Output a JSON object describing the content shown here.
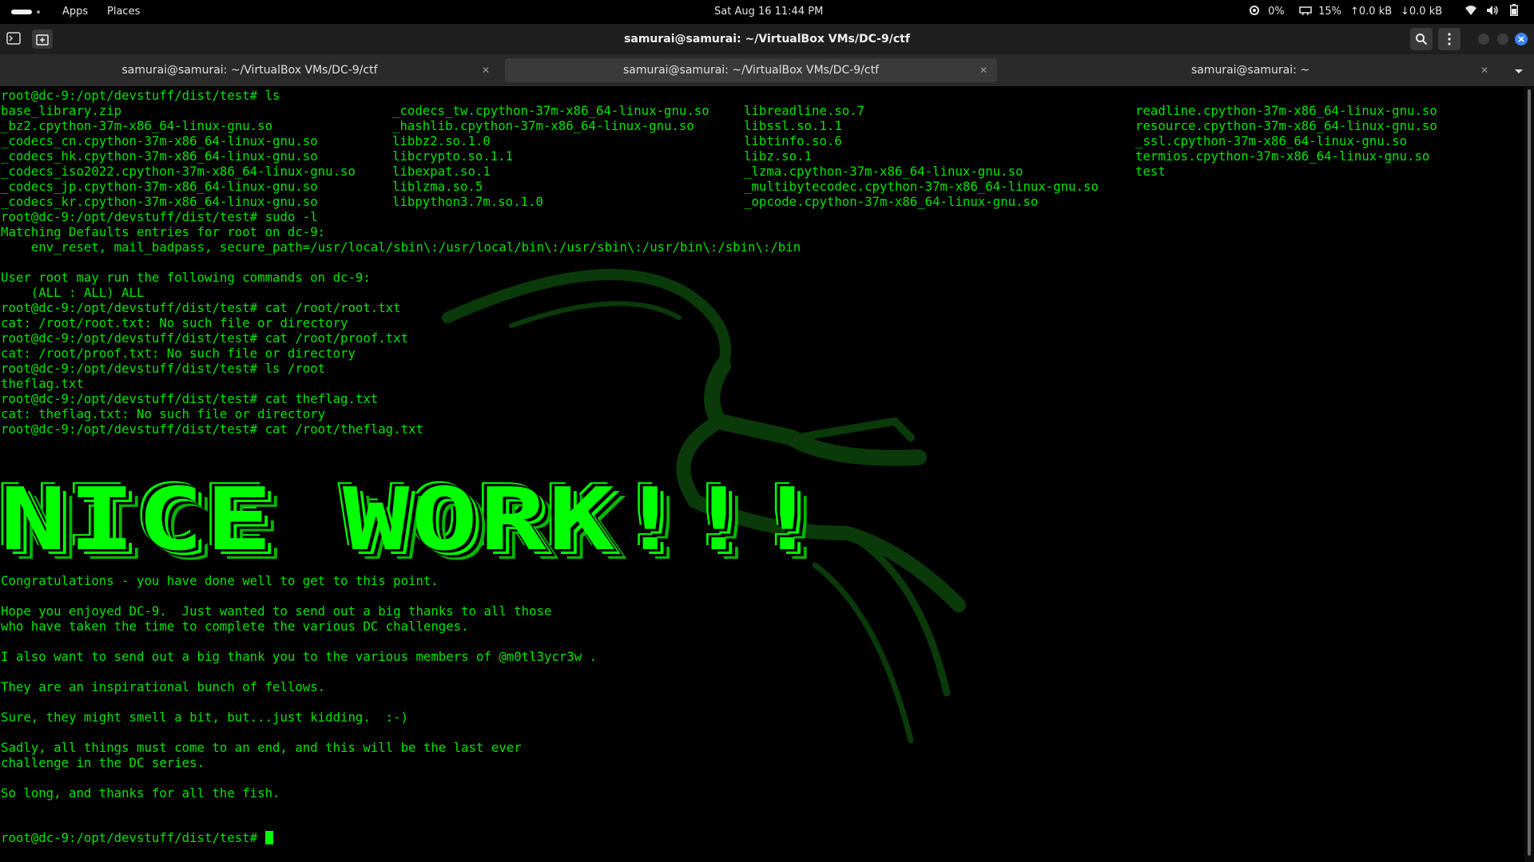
{
  "topbar": {
    "apps": "Apps",
    "places": "Places",
    "clock": "Sat Aug 16  11:44 PM",
    "cpu": "0%",
    "mem": "15%",
    "net_up": "0.0 kB",
    "net_down": "0.0 kB"
  },
  "window": {
    "title": "samurai@samurai: ~/VirtualBox VMs/DC-9/ctf"
  },
  "tabs": [
    {
      "label": "samurai@samurai: ~/VirtualBox VMs/DC-9/ctf"
    },
    {
      "label": "samurai@samurai: ~/VirtualBox VMs/DC-9/ctf"
    },
    {
      "label": "samurai@samurai: ~"
    }
  ],
  "terminal": {
    "prompt": "root@dc-9:/opt/devstuff/dist/test# ",
    "cmd_ls": "ls",
    "ls_col1": "base_library.zip\n_bz2.cpython-37m-x86_64-linux-gnu.so\n_codecs_cn.cpython-37m-x86_64-linux-gnu.so\n_codecs_hk.cpython-37m-x86_64-linux-gnu.so\n_codecs_iso2022.cpython-37m-x86_64-linux-gnu.so\n_codecs_jp.cpython-37m-x86_64-linux-gnu.so\n_codecs_kr.cpython-37m-x86_64-linux-gnu.so",
    "ls_col2": "_codecs_tw.cpython-37m-x86_64-linux-gnu.so\n_hashlib.cpython-37m-x86_64-linux-gnu.so\nlibbz2.so.1.0\nlibcrypto.so.1.1\nlibexpat.so.1\nliblzma.so.5\nlibpython3.7m.so.1.0",
    "ls_col3": "libreadline.so.7\nlibssl.so.1.1\nlibtinfo.so.6\nlibz.so.1\n_lzma.cpython-37m-x86_64-linux-gnu.so\n_multibytecodec.cpython-37m-x86_64-linux-gnu.so\n_opcode.cpython-37m-x86_64-linux-gnu.so",
    "ls_col4": "readline.cpython-37m-x86_64-linux-gnu.so\nresource.cpython-37m-x86_64-linux-gnu.so\n_ssl.cpython-37m-x86_64-linux-gnu.so\ntermios.cpython-37m-x86_64-linux-gnu.so\ntest",
    "session": "root@dc-9:/opt/devstuff/dist/test# sudo -l\nMatching Defaults entries for root on dc-9:\n    env_reset, mail_badpass, secure_path=/usr/local/sbin\\:/usr/local/bin\\:/usr/sbin\\:/usr/bin\\:/sbin\\:/bin\n\nUser root may run the following commands on dc-9:\n    (ALL : ALL) ALL\nroot@dc-9:/opt/devstuff/dist/test# cat /root/root.txt\ncat: /root/root.txt: No such file or directory\nroot@dc-9:/opt/devstuff/dist/test# cat /root/proof.txt\ncat: /root/proof.txt: No such file or directory\nroot@dc-9:/opt/devstuff/dist/test# ls /root\ntheflag.txt\nroot@dc-9:/opt/devstuff/dist/test# cat theflag.txt\ncat: theflag.txt: No such file or directory\nroot@dc-9:/opt/devstuff/dist/test# cat /root/theflag.txt",
    "banner": "NICE WORK!!!",
    "message": "Congratulations - you have done well to get to this point.\n\nHope you enjoyed DC-9.  Just wanted to send out a big thanks to all those\nwho have taken the time to complete the various DC challenges.\n\nI also want to send out a big thank you to the various members of @m0tl3ycr3w .\n\nThey are an inspirational bunch of fellows.\n\nSure, they might smell a bit, but...just kidding.  :-)\n\nSadly, all things must come to an end, and this will be the last ever\nchallenge in the DC series.\n\nSo long, and thanks for all the fish."
  },
  "icons": {
    "terminal": "terminal-icon",
    "new_tab": "new-tab-icon",
    "search": "search-icon",
    "menu": "menu-icon",
    "cpu": "cpu-icon",
    "mem": "memory-icon",
    "wifi": "wifi-icon",
    "volume": "volume-icon",
    "battery": "battery-icon",
    "close": "close-icon"
  },
  "colors": {
    "text": "#00e500",
    "banner": "#00ff00",
    "close_button": "#3b82f6",
    "dragon": "#0a3a0a"
  }
}
